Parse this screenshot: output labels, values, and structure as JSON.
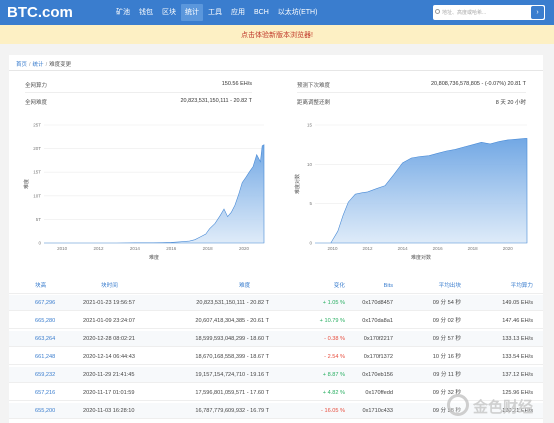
{
  "header": {
    "logo": "BTC.com",
    "nav": [
      "矿池",
      "钱包",
      "区块",
      "统计",
      "工具",
      "应用",
      "BCH",
      "以太坊(ETH)"
    ],
    "active_nav": "统计",
    "search_placeholder": "地址、高度或哈希..."
  },
  "banner": {
    "text": "点击体验新版本浏览器!"
  },
  "breadcrumb": {
    "home": "首页",
    "stats": "统计",
    "current": "难度变更"
  },
  "stats_left": [
    {
      "label": "全网算力",
      "value": "150.56 EH/s"
    },
    {
      "label": "全网难度",
      "value": "20,823,531,150,111 - 20.82 T"
    }
  ],
  "stats_right": [
    {
      "label": "预测下次难度",
      "value": "20,808,736,578,805 - (-0.07%) 20.81 T"
    },
    {
      "label": "距离调整还剩",
      "value": "8 天 20 小时"
    }
  ],
  "colors": {
    "brand": "#3a7dce",
    "positive": "#27ae60",
    "negative": "#e74c3c",
    "chart_fill": "#a8c8ec"
  },
  "chart_data": [
    {
      "type": "area",
      "xlabel": "难度",
      "ylabel": "难度",
      "x_ticks": [
        "2010",
        "2012",
        "2014",
        "2016",
        "2018",
        "2020"
      ],
      "y_ticks": [
        "0",
        "5T",
        "10T",
        "15T",
        "20T",
        "25T"
      ],
      "ylim": [
        0,
        25
      ],
      "grid": true,
      "series": [
        {
          "x": [
            2009,
            2010,
            2011,
            2012,
            2013,
            2013.5,
            2014,
            2014.5,
            2015,
            2015.5,
            2016,
            2016.5,
            2017,
            2017.3,
            2017.6,
            2017.9,
            2018.1,
            2018.4,
            2018.7,
            2018.9,
            2019.1,
            2019.3,
            2019.5,
            2019.7,
            2019.9,
            2020.1,
            2020.3,
            2020.5,
            2020.7,
            2020.9,
            2021,
            2021.1
          ],
          "y": [
            0,
            0,
            0,
            0,
            0.01,
            0.02,
            0.05,
            0.04,
            0.05,
            0.07,
            0.12,
            0.25,
            0.4,
            0.7,
            1.3,
            1.9,
            3.0,
            4.1,
            5.9,
            7.2,
            5.6,
            6.5,
            8.0,
            10.2,
            12.8,
            13.9,
            15.1,
            16.2,
            18.7,
            17.2,
            20.6,
            20.8
          ]
        }
      ]
    },
    {
      "type": "area",
      "xlabel": "难度对数",
      "ylabel": "难度对数",
      "x_ticks": [
        "2010",
        "2012",
        "2014",
        "2016",
        "2018",
        "2020"
      ],
      "y_ticks": [
        "0",
        "5",
        "10",
        "15"
      ],
      "ylim": [
        0,
        15
      ],
      "grid": true,
      "series": [
        {
          "x": [
            2009,
            2009.9,
            2010.3,
            2010.6,
            2010.9,
            2011.3,
            2011.7,
            2012,
            2012.5,
            2013,
            2013.5,
            2014,
            2014.5,
            2015,
            2015.5,
            2016,
            2016.5,
            2017,
            2017.5,
            2018,
            2018.5,
            2019,
            2019.5,
            2020,
            2020.5,
            2021,
            2021.1
          ],
          "y": [
            0,
            0,
            1.5,
            3.5,
            5.2,
            6.2,
            6.4,
            6.5,
            6.9,
            7.3,
            8.7,
            10.2,
            10.8,
            11.0,
            11.1,
            11.4,
            11.7,
            11.9,
            12.2,
            12.5,
            12.8,
            12.6,
            12.9,
            13.1,
            13.2,
            13.3,
            13.3
          ]
        }
      ]
    }
  ],
  "table": {
    "headers": [
      "块高",
      "块时间",
      "难度",
      "变化",
      "Bits",
      "平均出块",
      "平均算力"
    ],
    "rows": [
      {
        "height": "667,296",
        "time": "2021-01-23 19:56:57",
        "difficulty": "20,823,531,150,111 - 20.82 T",
        "change": "+ 1.05 %",
        "bits": "0x170d8457",
        "interval": "09 分 54 秒",
        "hashrate": "149.05 EH/s"
      },
      {
        "height": "665,280",
        "time": "2021-01-09 23:24:07",
        "difficulty": "20,607,418,304,385 - 20.61 T",
        "change": "+ 10.79 %",
        "bits": "0x170da8a1",
        "interval": "09 分 02 秒",
        "hashrate": "147.46 EH/s"
      },
      {
        "height": "663,264",
        "time": "2020-12-28 08:02:21",
        "difficulty": "18,599,593,048,299 - 18.60 T",
        "change": "- 0.38 %",
        "bits": "0x170f2217",
        "interval": "09 分 57 秒",
        "hashrate": "133.13 EH/s"
      },
      {
        "height": "661,248",
        "time": "2020-12-14 06:44:43",
        "difficulty": "18,670,168,558,399 - 18.67 T",
        "change": "- 2.54 %",
        "bits": "0x170f1372",
        "interval": "10 分 16 秒",
        "hashrate": "133.54 EH/s"
      },
      {
        "height": "659,232",
        "time": "2020-11-29 21:41:45",
        "difficulty": "19,157,154,724,710 - 19.16 T",
        "change": "+ 8.87 %",
        "bits": "0x170eb156",
        "interval": "09 分 11 秒",
        "hashrate": "137.12 EH/s"
      },
      {
        "height": "657,216",
        "time": "2020-11-17 01:01:59",
        "difficulty": "17,596,801,059,571 - 17.60 T",
        "change": "+ 4.82 %",
        "bits": "0x170ffedd",
        "interval": "09 分 32 秒",
        "hashrate": "125.96 EH/s"
      },
      {
        "height": "655,200",
        "time": "2020-11-03 16:28:10",
        "difficulty": "16,787,779,609,932 - 16.79 T",
        "change": "- 16.05 %",
        "bits": "0x1710c433",
        "interval": "09 分 58 秒",
        "hashrate": "120.21 EH/s"
      }
    ]
  },
  "watermark": {
    "text": "金色财经"
  }
}
